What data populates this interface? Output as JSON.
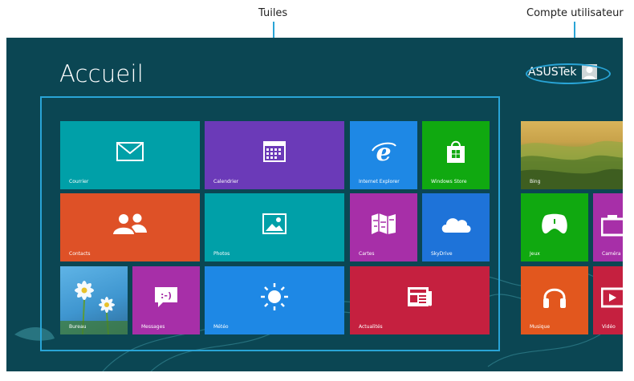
{
  "annotations": {
    "tiles": "Tuiles",
    "user_account": "Compte utilisateur"
  },
  "start_screen": {
    "title": "Accueil",
    "user_name": "ASUSTek",
    "background_color": "#0b4653",
    "highlight_color": "#29a4d6"
  },
  "tiles": [
    {
      "label": "Courrier",
      "color": "#00a0a8",
      "icon": "mail-icon"
    },
    {
      "label": "Calendrier",
      "color": "#6b3ab8",
      "icon": "calendar-icon"
    },
    {
      "label": "Internet Explorer",
      "color": "#1e88e5",
      "icon": "internet-explorer-icon"
    },
    {
      "label": "Windows Store",
      "color": "#10a910",
      "icon": "store-icon"
    },
    {
      "label": "Contacts",
      "color": "#de5127",
      "icon": "people-icon"
    },
    {
      "label": "Photos",
      "color": "#00a0a8",
      "icon": "photo-icon"
    },
    {
      "label": "Cartes",
      "color": "#a72fa8",
      "icon": "map-icon"
    },
    {
      "label": "SkyDrive",
      "color": "#1e73d9",
      "icon": "cloud-icon"
    },
    {
      "label": "Bureau",
      "color": "#3f96d0",
      "icon": "desktop-wallpaper"
    },
    {
      "label": "Messages",
      "color": "#a72fa8",
      "icon": "messaging-icon"
    },
    {
      "label": "Météo",
      "color": "#1e88e5",
      "icon": "sun-icon"
    },
    {
      "label": "Actualités",
      "color": "#c5203f",
      "icon": "news-icon"
    },
    {
      "label": "Bing",
      "color": "#8a8f3a",
      "icon": "landscape-image"
    },
    {
      "label": "Jeux",
      "color": "#10a910",
      "icon": "gamepad-icon"
    },
    {
      "label": "Caméra",
      "color": "#a72fa8",
      "icon": "camera-icon"
    },
    {
      "label": "Musique",
      "color": "#e2571e",
      "icon": "headphones-icon"
    },
    {
      "label": "Vidéo",
      "color": "#c5203f",
      "icon": "video-icon"
    }
  ]
}
